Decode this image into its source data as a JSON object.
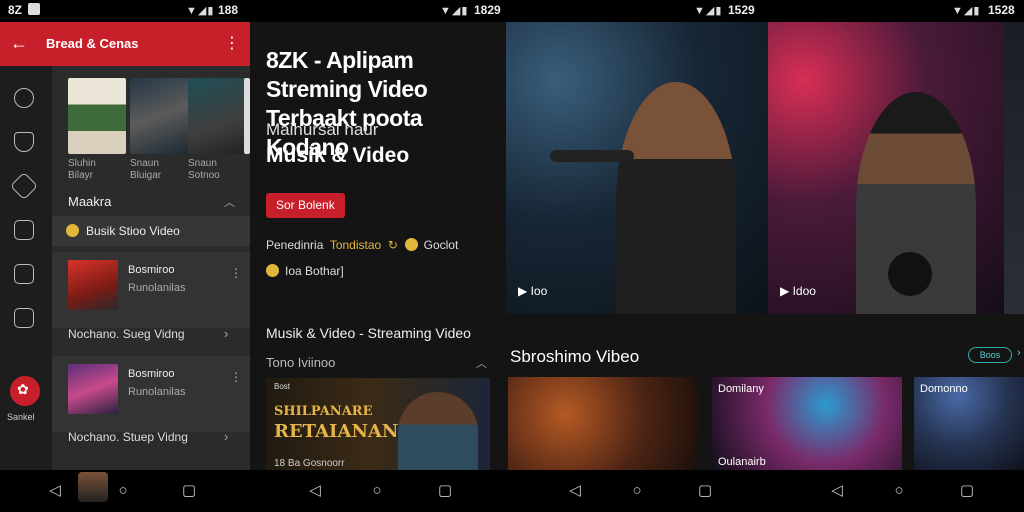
{
  "status": {
    "left_text": "8Z",
    "time_1": "188",
    "time_2": "1829",
    "time_3": "1529",
    "time_4": "1528"
  },
  "panel1": {
    "appbar_title": "Bread & Cenas",
    "thumbs": [
      {
        "caption_1": "Sluhin",
        "caption_2": "Bilayr"
      },
      {
        "caption_1": "Snaun",
        "caption_2": "Bluigar"
      },
      {
        "caption_1": "Snaun",
        "caption_2": "Sotnoo"
      }
    ],
    "section_title": "Maakra",
    "highlight_row": "Busik Stioo Video",
    "cards": [
      {
        "title": "Bosmiroo",
        "subtitle": "Runolanilas"
      },
      {
        "title": "Bosmiroo",
        "subtitle": "Runolanilas"
      }
    ],
    "link_rows": [
      "Nochano. Sueg Vidng",
      "Nochano. Stuep Vidng"
    ],
    "fab_label": "Sankel"
  },
  "panel2": {
    "hero_line1": "8ZK - Aplipam Streming Video",
    "hero_line2": "Terbaakt poota Kodano",
    "sub1": "Maihursal haur",
    "sub2": "Musik & Video",
    "cta": "Sor Bolenk",
    "meta1_label": "Penedinria",
    "meta1_hl": "Tondistao",
    "meta1_tail": "Goclot",
    "meta2": "Ioa Bothar]",
    "section_a": "Musik & Video - Streaming Video",
    "section_b": "Tono Iviinoo",
    "banner_tag": "Bost",
    "banner_line1": "SHILPANARE",
    "banner_line2": "RETAIANAN",
    "banner_foot": "18 Ba Gosnoorr"
  },
  "panel3": {
    "img1_label": "Ioo",
    "img2_label": "Idoo",
    "section_title": "Sbroshimo Vibeo",
    "pill_label": "Boos",
    "tiles": [
      {
        "label_top": "",
        "label_bottom": ""
      },
      {
        "label_top": "Domilany",
        "label_bottom": "Oulanairb"
      },
      {
        "label_top": "Domonno",
        "label_bottom": ""
      }
    ]
  },
  "colors": {
    "accent": "#c8202a",
    "gold": "#e1b63a",
    "teal": "#3aa"
  }
}
